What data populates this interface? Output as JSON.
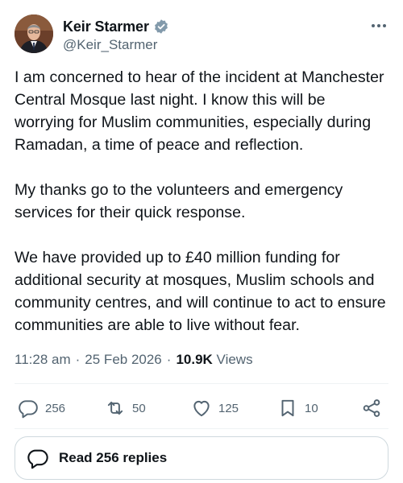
{
  "author": {
    "display_name": "Keir Starmer",
    "handle": "@Keir_Starmer",
    "verified": true,
    "verified_color": "#829aab"
  },
  "tweet": {
    "paragraphs": [
      "I am concerned to hear of the incident at Manchester Central Mosque last night. I know this will be worrying for Muslim communities, especially during Ramadan, a time of peace and reflection.",
      "My thanks go to the volunteers and emergency services for their quick response.",
      "We have provided up to £40 million funding for additional security at mosques, Muslim schools and community centres, and will continue to act to ensure communities are able to live without fear."
    ],
    "time": "11:28 am",
    "separator1": "·",
    "date": "25 Feb 2026",
    "separator2": "·",
    "views_count": "10.9K",
    "views_label": "Views"
  },
  "actions": {
    "replies": "256",
    "reposts": "50",
    "likes": "125",
    "bookmarks": "10"
  },
  "replies_button": {
    "label": "Read 256 replies"
  },
  "colors": {
    "text_primary": "#0f1419",
    "text_secondary": "#536471",
    "border": "#cfd9de",
    "divider": "#eff3f4"
  }
}
